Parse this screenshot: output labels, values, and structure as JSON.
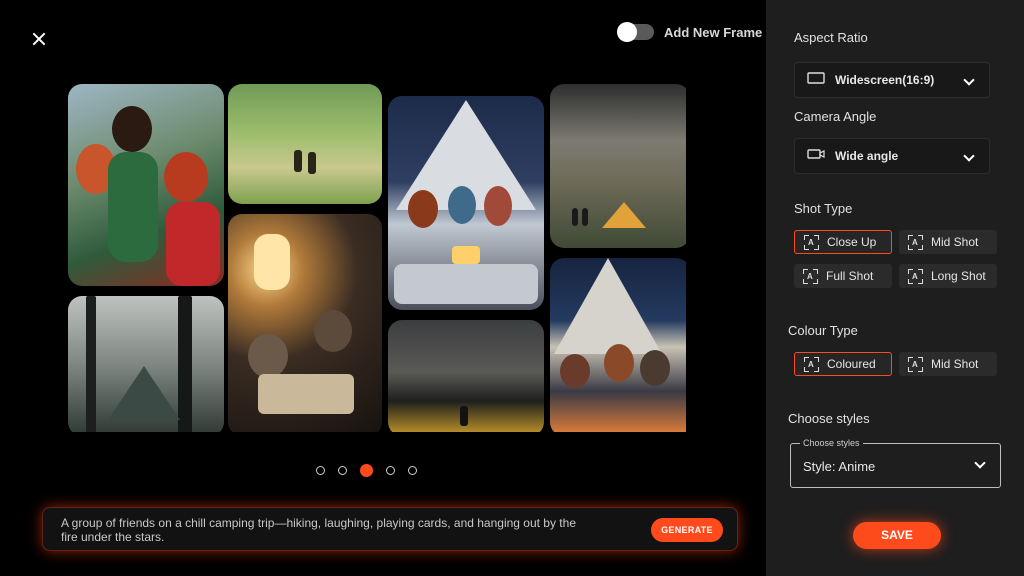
{
  "header": {
    "close_icon": "close-icon",
    "toggle_label": "Add New Frame",
    "toggle_on": false
  },
  "gallery": {
    "images": [
      {
        "name": "friends-walking-image"
      },
      {
        "name": "forest-path-hikers-image"
      },
      {
        "name": "tent-card-game-night-image"
      },
      {
        "name": "stormy-meadow-tent-image"
      },
      {
        "name": "lantern-card-game-image"
      },
      {
        "name": "misty-forest-tent-image"
      },
      {
        "name": "dark-clouds-field-image"
      },
      {
        "name": "campfire-under-stars-image"
      }
    ],
    "pagination": {
      "total": 5,
      "active": 3
    }
  },
  "prompt": {
    "text": "A group of friends on a chill camping trip—hiking, laughing, playing cards, and hanging out by the fire under the stars.",
    "generate_label": "GENERATE"
  },
  "panel": {
    "aspect_ratio": {
      "label": "Aspect Ratio",
      "value": "Widescreen(16:9)"
    },
    "camera_angle": {
      "label": "Camera Angle",
      "value": "Wide angle"
    },
    "shot_type": {
      "label": "Shot Type",
      "options": [
        "Close Up",
        "Mid Shot",
        "Full Shot",
        "Long Shot"
      ],
      "selected": "Close Up"
    },
    "colour_type": {
      "label": "Colour Type",
      "options": [
        "Coloured",
        "Mid Shot"
      ],
      "selected": "Coloured"
    },
    "styles": {
      "label": "Choose styles",
      "legend": "Choose styles",
      "value": "Style: Anime"
    },
    "save_label": "SAVE"
  },
  "colors": {
    "accent": "#ff4a1c",
    "panel_bg": "#1e1e1e",
    "main_bg": "#000000"
  }
}
